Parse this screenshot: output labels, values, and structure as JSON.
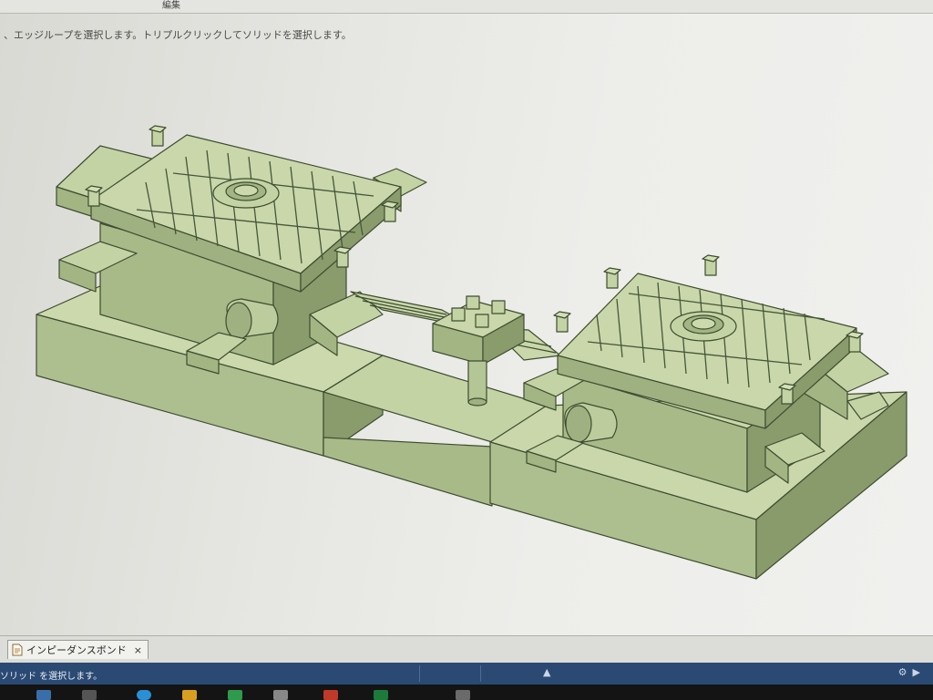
{
  "menubar": {
    "items": [
      "編集"
    ]
  },
  "prompt_text": "、エッジループを選択します。トリプルクリックしてソリッドを選択します。",
  "document_tab": {
    "label": "インピーダンスボンド",
    "close_symbol": "×",
    "icon": "document-icon"
  },
  "status_bar": {
    "text": "ソリッド を選択します。",
    "warning_symbol": "▲"
  },
  "colors": {
    "model_fill": "#b4c596",
    "model_light": "#cbd9ac",
    "model_dark": "#8a9c6c",
    "model_edge": "#3e4d30",
    "status_bar": "#2a4a73",
    "taskbar": "#141414"
  },
  "taskbar_icons": [
    "app-icon-1",
    "app-icon-2",
    "app-icon-3",
    "app-icon-4",
    "app-icon-5",
    "app-icon-6",
    "app-icon-7",
    "app-icon-8",
    "app-icon-9"
  ]
}
